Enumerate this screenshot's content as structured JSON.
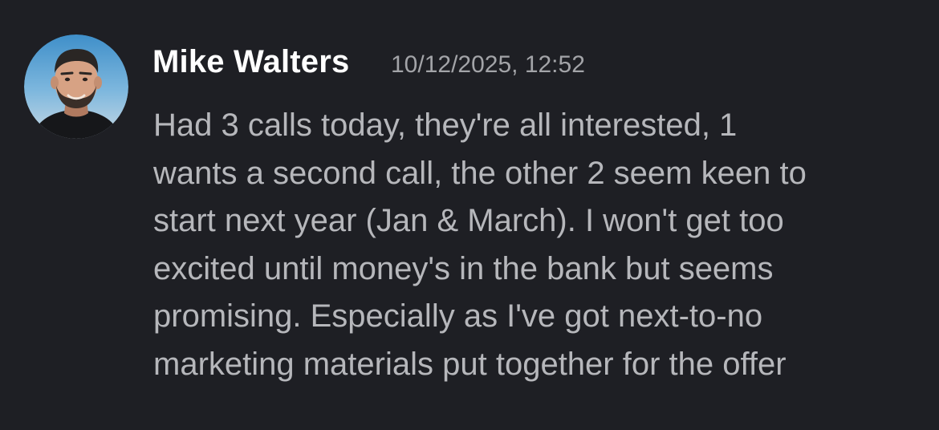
{
  "message": {
    "author": "Mike Walters",
    "timestamp": "10/12/2025, 12:52",
    "avatar": "user-avatar-photo",
    "text_lines": [
      "Had 3 calls today, they're all interested, 1",
      "wants a second call, the other 2 seem keen to",
      "start next year (Jan & March). I won't get too",
      "excited until money's in the bank but seems",
      "promising. Especially as I've got next-to-no",
      "marketing materials put together for the offer"
    ]
  },
  "colors": {
    "background": "#1e1f24",
    "author": "#ffffff",
    "timestamp": "#a3a4a8",
    "body_text": "#b6b7bb"
  }
}
